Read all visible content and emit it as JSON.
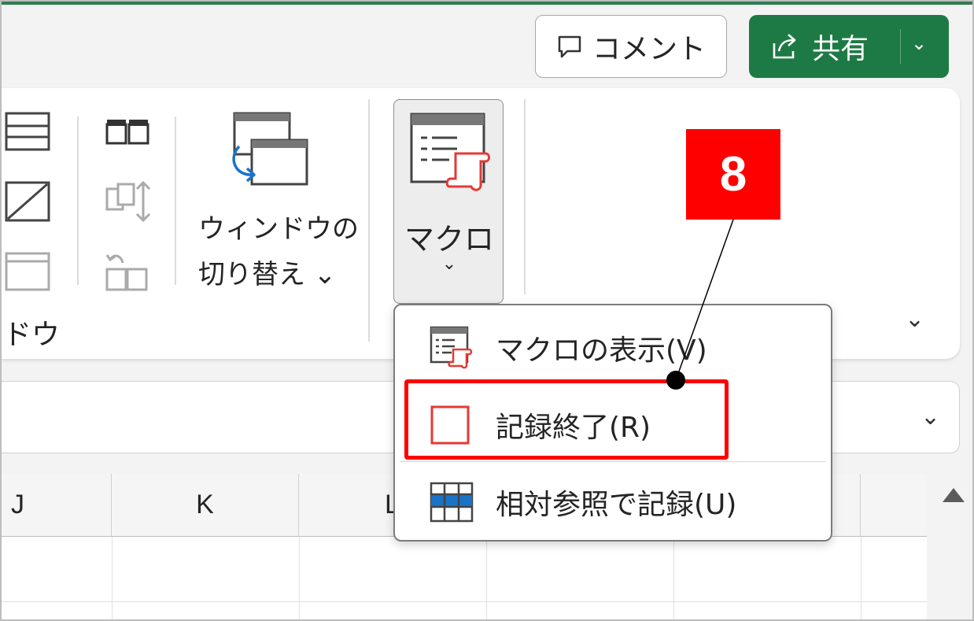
{
  "titlebar": {
    "comment_label": "コメント",
    "share_label": "共有"
  },
  "ribbon": {
    "window_group_label_partial": "ドウ",
    "switch_window_line1": "ウィンドウの",
    "switch_window_line2": "切り替え ⌄",
    "macro_label": "マクロ"
  },
  "macro_menu": {
    "items": [
      {
        "label": "マクロの表示(V)",
        "icon": "view-macros-icon"
      },
      {
        "label": "記録終了(R)",
        "icon": "stop-recording-icon"
      },
      {
        "label": "相対参照で記録(U)",
        "icon": "relative-reference-icon"
      }
    ]
  },
  "sheet": {
    "columns": [
      "J",
      "K",
      "L"
    ]
  },
  "annotation": {
    "step_number": "8",
    "color": "#ff0000"
  },
  "colors": {
    "share_green": "#1e7a44",
    "accent_red": "#ff0000"
  }
}
